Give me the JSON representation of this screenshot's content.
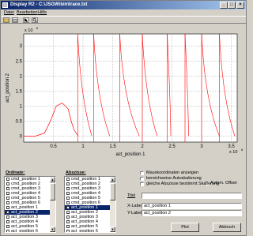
{
  "window": {
    "title": "Display R2 - C:\\JSGW\\bin\\trace.txt"
  },
  "menu": [
    "Datei",
    "Bearbeiten",
    "Hilfe"
  ],
  "chart_data": {
    "type": "line",
    "xlabel": "act_position 1",
    "ylabel": "act_position 2",
    "x_exponent_label": "x 10",
    "x_exponent": "6",
    "y_exponent_label": "x 10",
    "y_exponent": "6",
    "xlim": [
      0,
      3.6
    ],
    "ylim": [
      -0.2,
      3.4
    ],
    "xticks": [
      "0.5",
      "1",
      "1.5",
      "2",
      "2.5",
      "3",
      "3.5"
    ],
    "yticks": [
      "0",
      "0.5",
      "1",
      "1.5",
      "2",
      "2.5",
      "3"
    ],
    "grid": true,
    "series": [
      {
        "color": "#ff0000",
        "x": [
          0.0,
          0.2,
          0.35,
          0.45,
          0.55,
          0.65,
          0.75,
          0.8,
          0.85,
          0.92
        ],
        "y": [
          0,
          0,
          0.1,
          0.5,
          1.0,
          1.1,
          0.9,
          0.5,
          0.2,
          0.0
        ]
      }
    ],
    "sawtooth_segments": [
      {
        "x_top": 0.91,
        "x_bottom": 1.15
      },
      {
        "x_top": 1.18,
        "x_bottom": 1.45
      },
      {
        "x_top": 1.62,
        "x_bottom": 1.95
      },
      {
        "x_top": 2.0,
        "x_bottom": 2.25
      },
      {
        "x_top": 2.42,
        "x_bottom": 2.48
      },
      {
        "x_top": 2.72,
        "x_bottom": 2.78
      },
      {
        "x_top": 3.0,
        "x_bottom": 3.3
      },
      {
        "x_top": 3.3,
        "x_bottom": 3.56
      }
    ]
  },
  "ordinate": {
    "label": "Ordinate:",
    "items": [
      "cmd_position 1",
      "cmd_position 2",
      "cmd_position 3",
      "cmd_position 4",
      "cmd_position 5",
      "cmd_position 6",
      "act_position 1",
      "act_position 2",
      "act_position 3",
      "act_position 4",
      "act_position 5",
      "act_position 6"
    ],
    "selected_index": 7,
    "checked_index": 7
  },
  "abscissa": {
    "label": "Abszisse:",
    "items": [
      "cmd_position 1",
      "cmd_position 2",
      "cmd_position 3",
      "cmd_position 4",
      "cmd_position 5",
      "cmd_position 6",
      "act_position 1",
      "act_position 2",
      "act_position 3",
      "act_position 4",
      "act_position 5",
      "act_position 6"
    ],
    "selected_index": 6
  },
  "options": {
    "maus": "Mauskoordinaten anzeigen",
    "bereich": "bereichweise Autoskalierung",
    "offset": "Autom. Offset",
    "gleich": "gleiche Abszisse bestimmt Skalierung",
    "offset_checked": false
  },
  "fields": {
    "titel_label": "Titel",
    "titel_value": "",
    "xlabel_label": "X-Label",
    "xlabel_value": "act_position 1",
    "ylabel_label": "Y-Label",
    "ylabel_value": "act_position 2"
  },
  "buttons": {
    "plot": "Plot",
    "abbruch": "Abbruch"
  }
}
